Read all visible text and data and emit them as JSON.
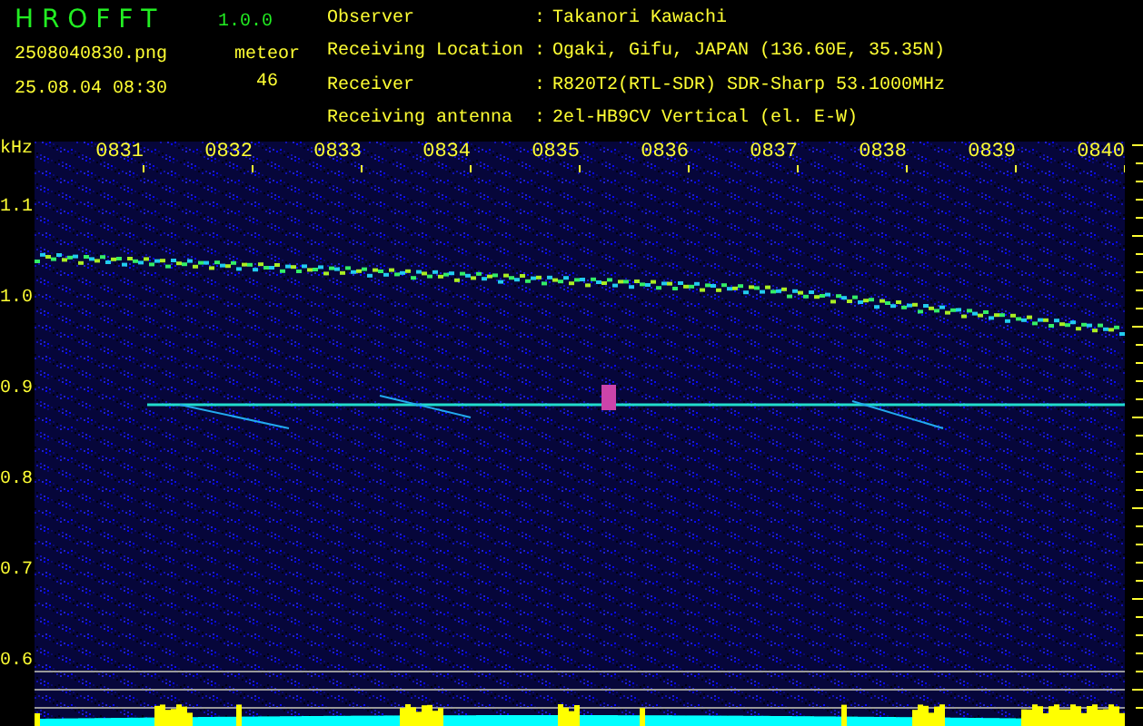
{
  "app": {
    "title": "H R O F F T",
    "version": "1.0.0"
  },
  "file": {
    "name": "2508040830.png",
    "timestamp": "25.08.04 08:30"
  },
  "counter": {
    "label": "meteor",
    "value": "46"
  },
  "info": [
    {
      "label": "Observer",
      "separator": ":",
      "value": "Takanori Kawachi"
    },
    {
      "label": "Receiving Location",
      "separator": ":",
      "value": "Ogaki, Gifu, JAPAN (136.60E, 35.35N)"
    },
    {
      "label": "Receiver",
      "separator": ":",
      "value": "R820T2(RTL-SDR) SDR-Sharp 53.1000MHz"
    },
    {
      "label": "Receiving antenna",
      "separator": ":",
      "value": "2el-HB9CV Vertical (el. E-W)"
    }
  ],
  "spectrogram": {
    "unit": "kHz",
    "time_labels": [
      "0831",
      "0832",
      "0833",
      "0834",
      "0835",
      "0836",
      "0837",
      "0838",
      "0839",
      "0840"
    ],
    "freq_labels": [
      "1.1",
      "1.0",
      "0.9",
      "0.8",
      "0.7",
      "0.6"
    ]
  }
}
